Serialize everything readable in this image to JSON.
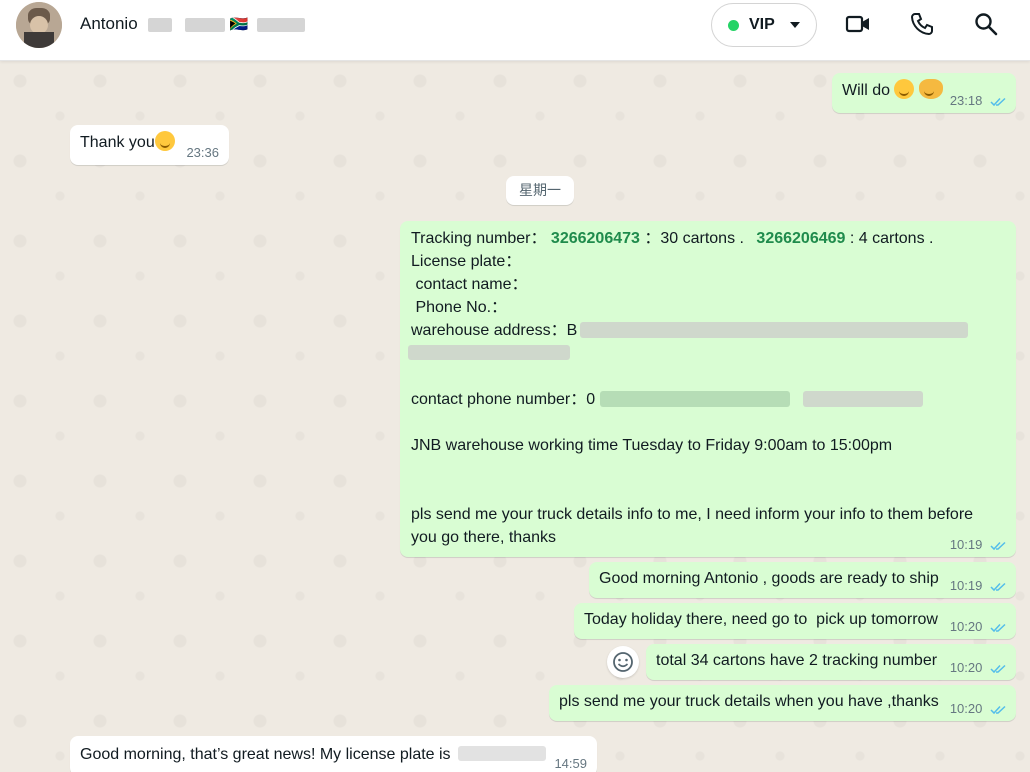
{
  "header": {
    "contact_name": "Antonio",
    "flag": "🇿🇦",
    "vip_label": "VIP",
    "icons": [
      "video-call-icon",
      "voice-call-icon",
      "search-icon"
    ]
  },
  "day_separator": "星期一",
  "messages": [
    {
      "text": "Will do",
      "time": "23:18"
    },
    {
      "text": "Thank you",
      "time": "23:36"
    },
    {
      "tracking_label": "Tracking number：",
      "tracking_1": "3266206473",
      "cartons_1": "：30 cartons .",
      "tracking_2": "3266206469",
      "cartons_2": ": 4 cartons .",
      "license_plate": "License plate：",
      "contact_name": " contact name：",
      "phone_no": " Phone No.：",
      "warehouse_address": "warehouse address：B",
      "contact_phone": "contact phone number：0",
      "working_time": "JNB warehouse working time Tuesday to Friday 9:00am to 15:00pm",
      "request_line1": "pls send me your truck details info to me, I need inform your info to them before",
      "request_line2": "you go there, thanks",
      "time": "10:19"
    },
    {
      "text": "Good morning Antonio , goods are ready to ship",
      "time": "10:19"
    },
    {
      "text": "Today holiday there, need go to  pick up tomorrow",
      "time": "10:20"
    },
    {
      "text": "total 34 cartons have 2 tracking number",
      "time": "10:20"
    },
    {
      "text": "pls send me your truck details when you have ,thanks",
      "time": "10:20"
    },
    {
      "text": "Good morning, that’s great news! My license plate is",
      "time": "14:59"
    }
  ]
}
